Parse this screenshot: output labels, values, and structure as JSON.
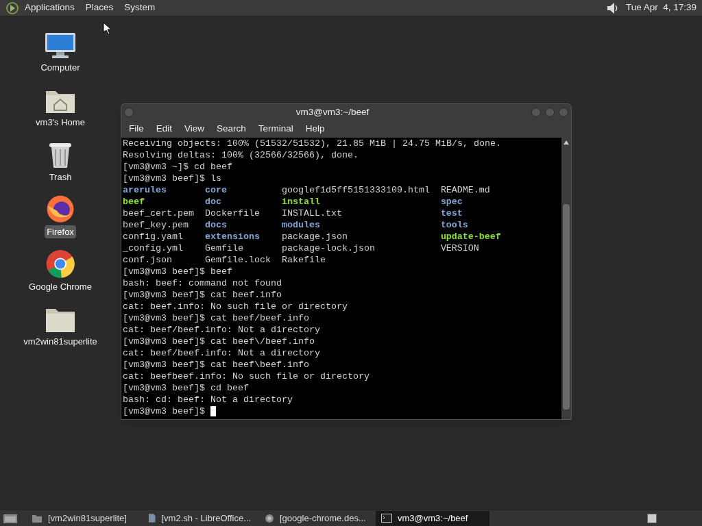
{
  "top_panel": {
    "menus": [
      "Applications",
      "Places",
      "System"
    ],
    "clock": "Tue Apr  4, 17:39"
  },
  "desktop_icons": [
    {
      "label": "Computer",
      "kind": "computer",
      "selected": false
    },
    {
      "label": "vm3's Home",
      "kind": "home",
      "selected": false
    },
    {
      "label": "Trash",
      "kind": "trash",
      "selected": false
    },
    {
      "label": "Firefox",
      "kind": "firefox",
      "selected": true
    },
    {
      "label": "Google Chrome",
      "kind": "chrome",
      "selected": false
    },
    {
      "label": "vm2win81superlite",
      "kind": "folder",
      "selected": false
    }
  ],
  "terminal": {
    "title": "vm3@vm3:~/beef",
    "menu": [
      "File",
      "Edit",
      "View",
      "Search",
      "Terminal",
      "Help"
    ],
    "lines_before": [
      "Receiving objects: 100% (51532/51532), 21.85 MiB | 24.75 MiB/s, done.",
      "Resolving deltas: 100% (32566/32566), done.",
      "[vm3@vm3 ~]$ cd beef",
      "[vm3@vm3 beef]$ ls"
    ],
    "listing": [
      [
        {
          "name": "arerules",
          "kind": "dir"
        },
        {
          "name": "core",
          "kind": "dir"
        },
        {
          "name": "googlef1d5ff5151333109.html",
          "kind": "file"
        },
        {
          "name": "README.md",
          "kind": "file"
        }
      ],
      [
        {
          "name": "beef",
          "kind": "exec"
        },
        {
          "name": "doc",
          "kind": "dir"
        },
        {
          "name": "install",
          "kind": "exec"
        },
        {
          "name": "spec",
          "kind": "dir"
        }
      ],
      [
        {
          "name": "beef_cert.pem",
          "kind": "file"
        },
        {
          "name": "Dockerfile",
          "kind": "file"
        },
        {
          "name": "INSTALL.txt",
          "kind": "file"
        },
        {
          "name": "test",
          "kind": "dir"
        }
      ],
      [
        {
          "name": "beef_key.pem",
          "kind": "file"
        },
        {
          "name": "docs",
          "kind": "dir"
        },
        {
          "name": "modules",
          "kind": "dir"
        },
        {
          "name": "tools",
          "kind": "dir"
        }
      ],
      [
        {
          "name": "config.yaml",
          "kind": "file"
        },
        {
          "name": "extensions",
          "kind": "dir"
        },
        {
          "name": "package.json",
          "kind": "file"
        },
        {
          "name": "update-beef",
          "kind": "exec"
        }
      ],
      [
        {
          "name": "_config.yml",
          "kind": "file"
        },
        {
          "name": "Gemfile",
          "kind": "file"
        },
        {
          "name": "package-lock.json",
          "kind": "file"
        },
        {
          "name": "VERSION",
          "kind": "file"
        }
      ],
      [
        {
          "name": "conf.json",
          "kind": "file"
        },
        {
          "name": "Gemfile.lock",
          "kind": "file"
        },
        {
          "name": "Rakefile",
          "kind": "file"
        }
      ]
    ],
    "lines_after": [
      "[vm3@vm3 beef]$ beef",
      "bash: beef: command not found",
      "[vm3@vm3 beef]$ cat beef.info",
      "cat: beef.info: No such file or directory",
      "[vm3@vm3 beef]$ cat beef/beef.info",
      "cat: beef/beef.info: Not a directory",
      "[vm3@vm3 beef]$ cat beef\\/beef.info",
      "cat: beef/beef.info: Not a directory",
      "[vm3@vm3 beef]$ cat beef\\beef.info",
      "cat: beefbeef.info: No such file or directory",
      "[vm3@vm3 beef]$ cd beef",
      "bash: cd: beef: Not a directory"
    ],
    "prompt": "[vm3@vm3 beef]$"
  },
  "taskbar": [
    {
      "label": "[vm2win81superlite]",
      "kind": "folder",
      "selected": false
    },
    {
      "label": "[vm2.sh - LibreOffice...",
      "kind": "document",
      "selected": false
    },
    {
      "label": "[google-chrome.des...",
      "kind": "chrome",
      "selected": false
    },
    {
      "label": "vm3@vm3:~/beef",
      "kind": "terminal",
      "selected": true
    }
  ]
}
